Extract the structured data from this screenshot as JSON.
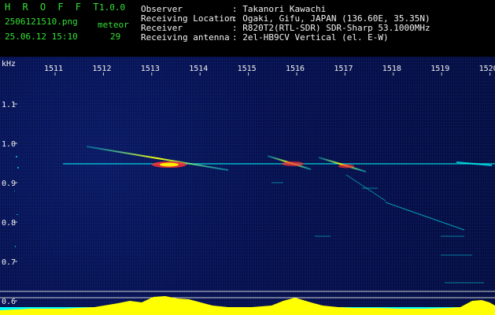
{
  "app": {
    "title_letters": "H R O F F T",
    "version": "1.0.0",
    "filename": "2506121510.png",
    "datetime": "25.06.12 15:10",
    "meteor_label": "meteor",
    "meteor_count": "29"
  },
  "info": {
    "observer_key": "Observer",
    "observer_value": ": Takanori Kawachi",
    "location_key": "Receiving Location",
    "location_value": ": Ogaki, Gifu, JAPAN (136.60E, 35.35N)",
    "receiver_key": "Receiver",
    "receiver_value": ": R820T2(RTL-SDR) SDR-Sharp 53.1000MHz",
    "antenna_key": "Receiving antenna",
    "antenna_value": ": 2el-HB9CV Vertical (el. E-W)"
  },
  "plot": {
    "unit_label": "kHz",
    "time_ticks": [
      "1511",
      "1512",
      "1513",
      "1514",
      "1515",
      "1516",
      "1517",
      "1518",
      "1519",
      "1520"
    ],
    "freq_ticks": [
      "1.1",
      "1.0",
      "0.9",
      "0.8",
      "0.7",
      "0.6"
    ],
    "colors": {
      "bg": "#06104a",
      "signal_yellow": "#ffff00",
      "signal_cyan": "#00ffff",
      "echo_red": "#ff3030"
    }
  }
}
